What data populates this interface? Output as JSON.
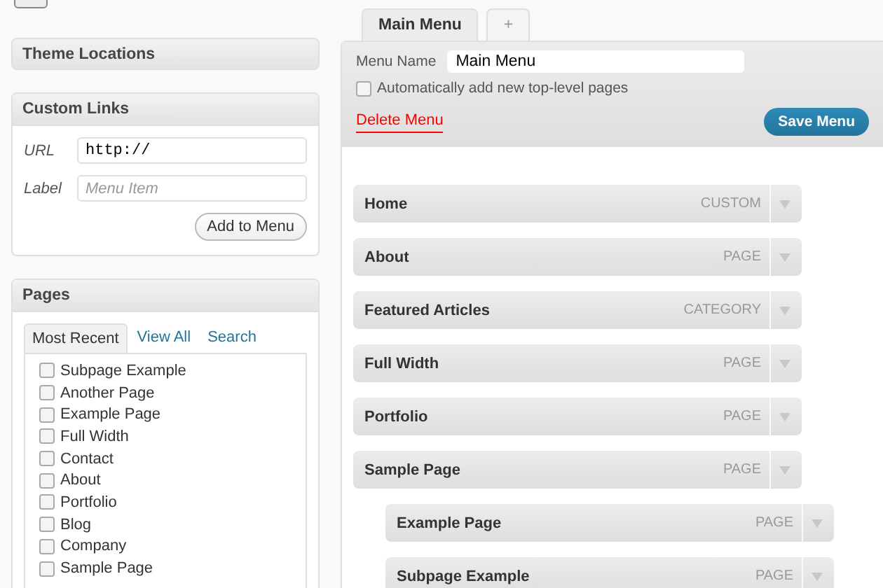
{
  "sidebar": {
    "theme_locations": {
      "title": "Theme Locations"
    },
    "custom_links": {
      "title": "Custom Links",
      "url_label": "URL",
      "url_value": "http://",
      "label_label": "Label",
      "label_placeholder": "Menu Item",
      "button": "Add to Menu"
    },
    "pages": {
      "title": "Pages",
      "tabs": [
        {
          "label": "Most Recent",
          "selected": true
        },
        {
          "label": "View All",
          "selected": false
        },
        {
          "label": "Search",
          "selected": false
        }
      ],
      "items": [
        {
          "label": "Subpage Example",
          "checked": false
        },
        {
          "label": "Another Page",
          "checked": false
        },
        {
          "label": "Example Page",
          "checked": false
        },
        {
          "label": "Full Width",
          "checked": false
        },
        {
          "label": "Contact",
          "checked": false
        },
        {
          "label": "About",
          "checked": false
        },
        {
          "label": "Portfolio",
          "checked": false
        },
        {
          "label": "Blog",
          "checked": false
        },
        {
          "label": "Company",
          "checked": false
        },
        {
          "label": "Sample Page",
          "checked": false
        }
      ]
    }
  },
  "menu_tabs": [
    {
      "label": "Main Menu",
      "selected": true
    },
    {
      "label": "+",
      "selected": false
    }
  ],
  "menu": {
    "name_label": "Menu Name",
    "name_value": "Main Menu",
    "auto_add": {
      "label": "Automatically add new top-level pages",
      "checked": false
    },
    "delete": "Delete Menu",
    "save": "Save Menu",
    "items": [
      {
        "title": "Home",
        "type": "CUSTOM"
      },
      {
        "title": "About",
        "type": "PAGE"
      },
      {
        "title": "Featured Articles",
        "type": "CATEGORY"
      },
      {
        "title": "Full Width",
        "type": "PAGE"
      },
      {
        "title": "Portfolio",
        "type": "PAGE"
      },
      {
        "title": "Sample Page",
        "type": "PAGE",
        "children": [
          {
            "title": "Example Page",
            "type": "PAGE"
          },
          {
            "title": "Subpage Example",
            "type": "PAGE"
          }
        ]
      }
    ]
  }
}
